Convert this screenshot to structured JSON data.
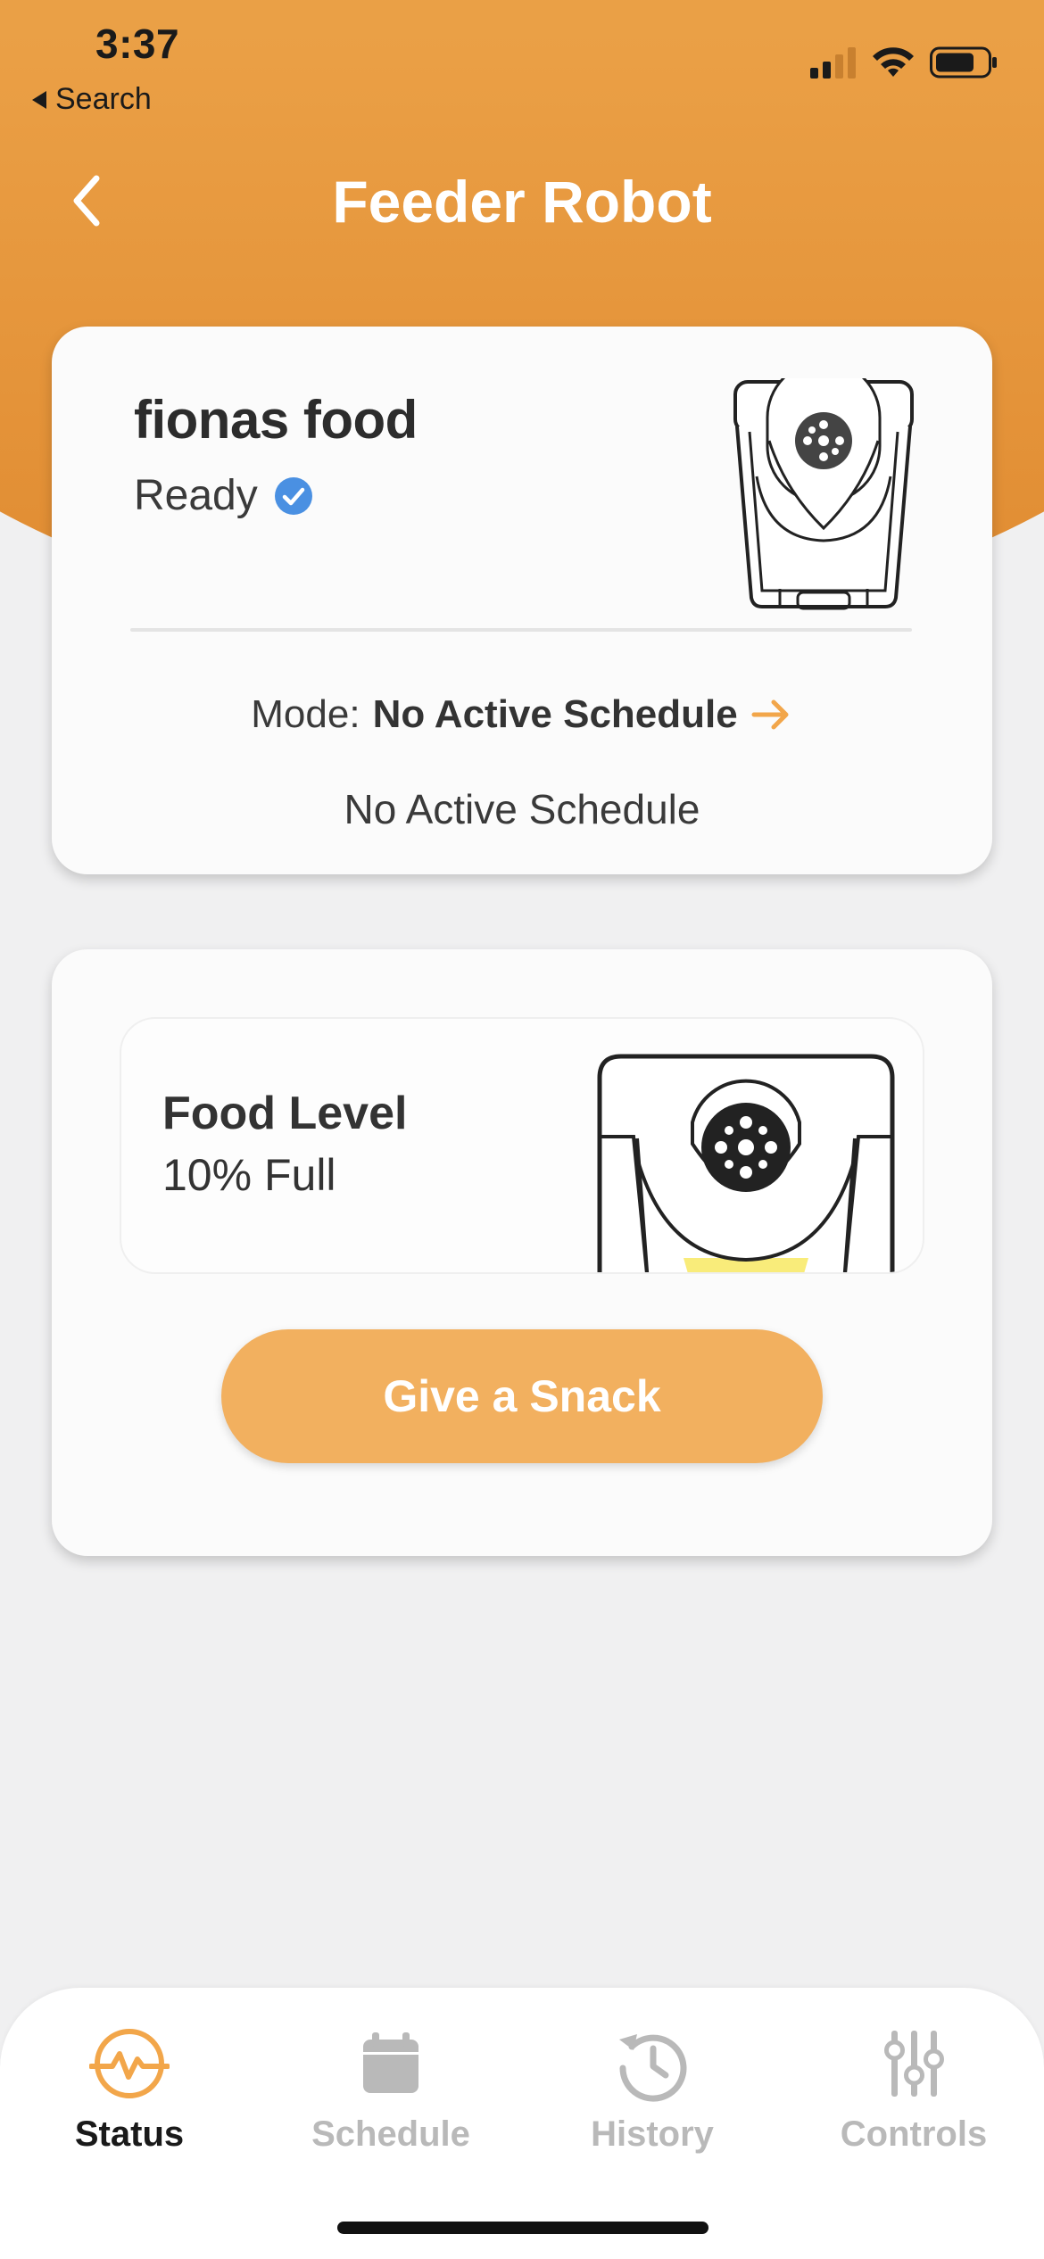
{
  "status_bar": {
    "time": "3:37",
    "back_label": "Search"
  },
  "header": {
    "title": "Feeder Robot"
  },
  "device_card": {
    "name": "fionas food",
    "status": "Ready",
    "mode_label": "Mode:",
    "mode_value": "No Active Schedule",
    "schedule_text": "No Active Schedule"
  },
  "food_card": {
    "level_title": "Food Level",
    "level_text": "10% Full",
    "level_fraction": 0.1,
    "snack_button": "Give a Snack"
  },
  "tabs": [
    {
      "label": "Status",
      "icon": "activity-icon",
      "active": true
    },
    {
      "label": "Schedule",
      "icon": "calendar-icon",
      "active": false
    },
    {
      "label": "History",
      "icon": "history-icon",
      "active": false
    },
    {
      "label": "Controls",
      "icon": "sliders-icon",
      "active": false
    }
  ],
  "colors": {
    "accent": "#f2b05f",
    "header_orange": "#ea9f45",
    "verified_blue": "#4a90e2",
    "food_yellow": "#f9ec7a",
    "inactive_tab": "#b9b9b9"
  }
}
